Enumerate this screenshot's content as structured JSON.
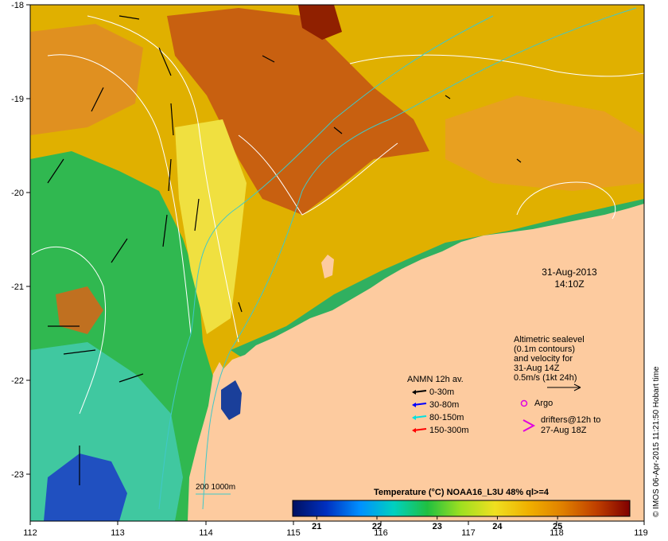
{
  "map": {
    "date": "31-Aug-2013",
    "time": "14:10Z",
    "lon_ticks": [
      "112",
      "113",
      "114",
      "115",
      "116",
      "117",
      "118",
      "119"
    ],
    "lat_ticks": [
      "-18",
      "-19",
      "-20",
      "-21",
      "-22",
      "-23"
    ],
    "lon_range": [
      112,
      119
    ],
    "lat_range": [
      -23.55,
      -18
    ],
    "colors": {
      "land": "#fdcb9f",
      "contour": "#ffffff",
      "isobath": "#40c8c8"
    }
  },
  "colorbar": {
    "title": "Temperature (°C) NOAA16_L3U 48% ql>=4",
    "ticks": [
      "21",
      "22",
      "23",
      "24",
      "25"
    ],
    "range": [
      20.6,
      26.2
    ],
    "stops": [
      "#001060",
      "#0030c0",
      "#0090ff",
      "#00d0c0",
      "#20c040",
      "#a0e020",
      "#f0e020",
      "#f0b000",
      "#e08000",
      "#c04000",
      "#800000"
    ]
  },
  "anmn": {
    "title": "ANMN 12h av.",
    "entries": [
      {
        "label": "0-30m",
        "color": "#000000"
      },
      {
        "label": "30-80m",
        "color": "#0000ff"
      },
      {
        "label": "80-150m",
        "color": "#00e0e0"
      },
      {
        "label": "150-300m",
        "color": "#ff0000"
      }
    ]
  },
  "altimetry": {
    "lines": [
      "Altimetric sealevel",
      "(0.1m contours)",
      "and velocity for",
      "31-Aug 14Z",
      "0.5m/s (1kt 24h)"
    ]
  },
  "argo": {
    "label": "Argo",
    "color": "#e000e0"
  },
  "drifters": {
    "lines": [
      "drifters@12h to",
      "27-Aug 18Z"
    ],
    "color": "#e000e0"
  },
  "isobath_label": "200  1000m",
  "credit": "© IMOS 06-Apr-2015 11:21:50 Hobart time"
}
